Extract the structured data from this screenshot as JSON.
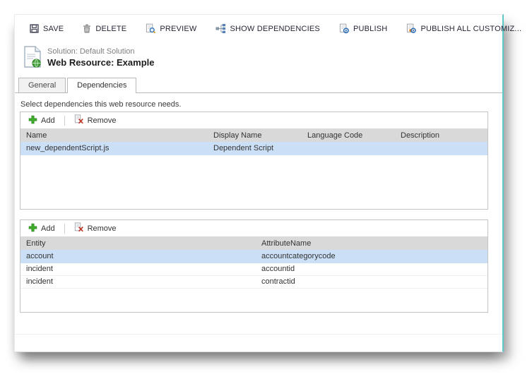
{
  "window": {
    "toolbar": {
      "items": [
        {
          "label": "SAVE",
          "icon": "save-icon"
        },
        {
          "label": "DELETE",
          "icon": "delete-icon"
        },
        {
          "label": "PREVIEW",
          "icon": "preview-icon"
        },
        {
          "label": "SHOW DEPENDENCIES",
          "icon": "show-dependencies-icon"
        },
        {
          "label": "PUBLISH",
          "icon": "publish-icon"
        },
        {
          "label": "PUBLISH ALL CUSTOMIZ...",
          "icon": "publish-all-icon"
        }
      ]
    },
    "header": {
      "solution_label": "Solution: Default Solution",
      "title": "Web Resource: Example",
      "icon": "web-resource-icon"
    },
    "tabs": [
      {
        "label": "General",
        "active": false
      },
      {
        "label": "Dependencies",
        "active": true
      }
    ],
    "instruction": "Select dependencies this web resource needs.",
    "grids": [
      {
        "toolbar": {
          "add_label": "Add",
          "remove_label": "Remove"
        },
        "columns": [
          "Name",
          "Display Name",
          "Language Code",
          "Description"
        ],
        "rows": [
          {
            "cells": [
              "new_dependentScript.js",
              "Dependent Script",
              "",
              ""
            ],
            "selected": true
          }
        ]
      },
      {
        "toolbar": {
          "add_label": "Add",
          "remove_label": "Remove"
        },
        "columns": [
          "Entity",
          "AttributeName"
        ],
        "rows": [
          {
            "cells": [
              "account",
              "accountcategorycode"
            ],
            "selected": true
          },
          {
            "cells": [
              "incident",
              "accountid"
            ],
            "selected": false
          },
          {
            "cells": [
              "incident",
              "contractid"
            ],
            "selected": false
          }
        ]
      }
    ],
    "colors": {
      "accent_border": "#5fc8ca",
      "selected_row": "#cbe0f7",
      "grid_header_bg": "#d9d9d9",
      "add_green": "#3fae2a",
      "remove_red": "#c0392b",
      "publish_blue": "#2e6fb7"
    }
  }
}
